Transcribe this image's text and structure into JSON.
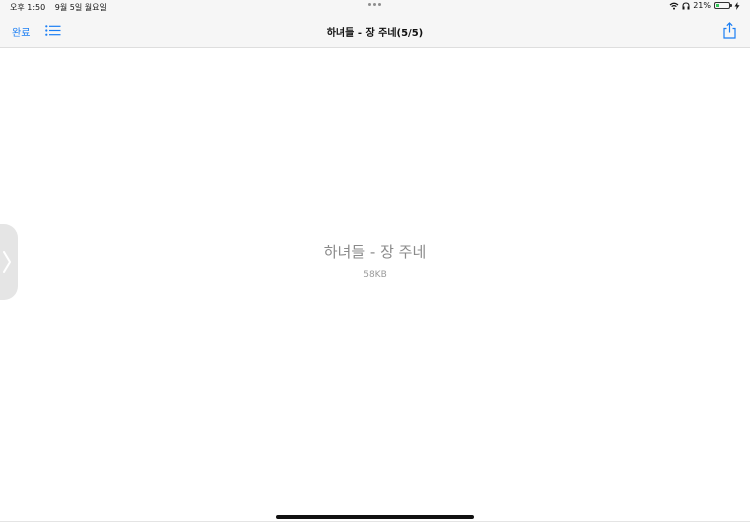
{
  "status_bar": {
    "time": "오후 1:50",
    "date": "9월 5일 월요일",
    "battery": "21%",
    "icons": [
      "wifi-icon",
      "headphones-icon",
      "battery-icon",
      "charging-icon"
    ]
  },
  "nav": {
    "done_label": "완료",
    "title": "하녀들 - 장 주네(5/5)",
    "icons": [
      "list-icon",
      "share-icon"
    ]
  },
  "file": {
    "name": "하녀들 - 장 주네",
    "size": "58KB"
  },
  "colors": {
    "accent": "#1a7ef4",
    "bar_background": "#f6f6f6",
    "battery_green": "#34c759"
  }
}
